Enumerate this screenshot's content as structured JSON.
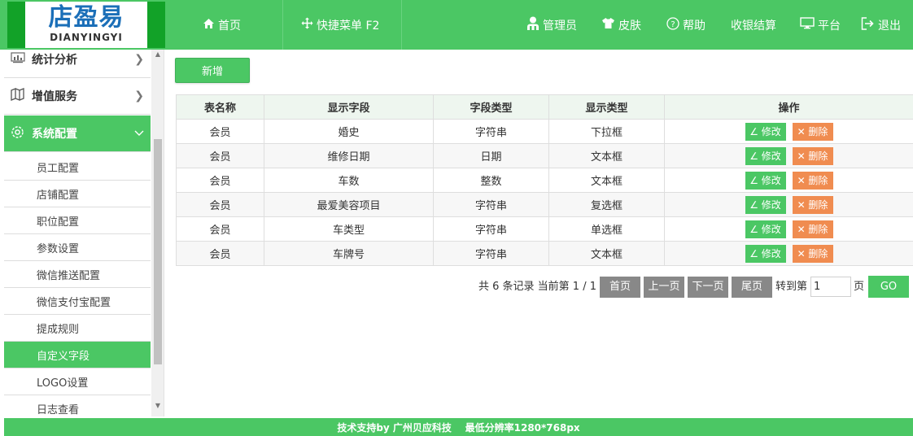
{
  "logo": {
    "zh": "店盈易",
    "en": "DIANYINGYI"
  },
  "nav": {
    "home": {
      "icon": "home-icon",
      "label": "首页"
    },
    "shortcut": {
      "icon": "move-icon",
      "label": "快捷菜单 F2"
    },
    "admin": {
      "icon": "user-icon",
      "label": "管理员"
    },
    "skin": {
      "icon": "tshirt-icon",
      "label": "皮肤"
    },
    "help": {
      "icon": "question-icon",
      "label": "帮助"
    },
    "cashier": {
      "label": "收银结算"
    },
    "platform": {
      "icon": "monitor-icon",
      "label": "平台"
    },
    "logout": {
      "icon": "logout-icon",
      "label": "退出"
    }
  },
  "sidebar": {
    "groups": [
      {
        "icon": "chart-icon",
        "label": "统计分析",
        "expanded": false
      },
      {
        "icon": "book-icon",
        "label": "增值服务",
        "expanded": false
      },
      {
        "icon": "gear-icon",
        "label": "系统配置",
        "expanded": true
      }
    ],
    "items": [
      {
        "label": "员工配置"
      },
      {
        "label": "店铺配置"
      },
      {
        "label": "职位配置"
      },
      {
        "label": "参数设置"
      },
      {
        "label": "微信推送配置"
      },
      {
        "label": "微信支付宝配置"
      },
      {
        "label": "提成规则"
      },
      {
        "label": "自定义字段",
        "active": true
      },
      {
        "label": "LOGO设置"
      },
      {
        "label": "日志查看"
      }
    ]
  },
  "toolbar": {
    "add_label": "新增"
  },
  "table": {
    "headers": [
      "表名称",
      "显示字段",
      "字段类型",
      "显示类型",
      "操作"
    ],
    "rows": [
      [
        "会员",
        "婚史",
        "字符串",
        "下拉框"
      ],
      [
        "会员",
        "维修日期",
        "日期",
        "文本框"
      ],
      [
        "会员",
        "车数",
        "整数",
        "文本框"
      ],
      [
        "会员",
        "最爱美容项目",
        "字符串",
        "复选框"
      ],
      [
        "会员",
        "车类型",
        "字符串",
        "单选框"
      ],
      [
        "会员",
        "车牌号",
        "字符串",
        "文本框"
      ]
    ],
    "edit_label": "∠ 修改",
    "delete_label": "✕ 删除"
  },
  "pager": {
    "info": "共 6 条记录 当前第 1 / 1",
    "first": "首页",
    "prev": "上一页",
    "next": "下一页",
    "last": "尾页",
    "goto_label": "转到第",
    "goto_value": "1",
    "page_unit": "页",
    "go": "GO"
  },
  "footer": {
    "text": "技术支持by 广州贝应科技    最低分辨率1280*768px"
  },
  "colors": {
    "accent": "#4bc764",
    "danger": "#f08c50",
    "pager_gray": "#888888",
    "logo_blue": "#1b6fb8"
  }
}
